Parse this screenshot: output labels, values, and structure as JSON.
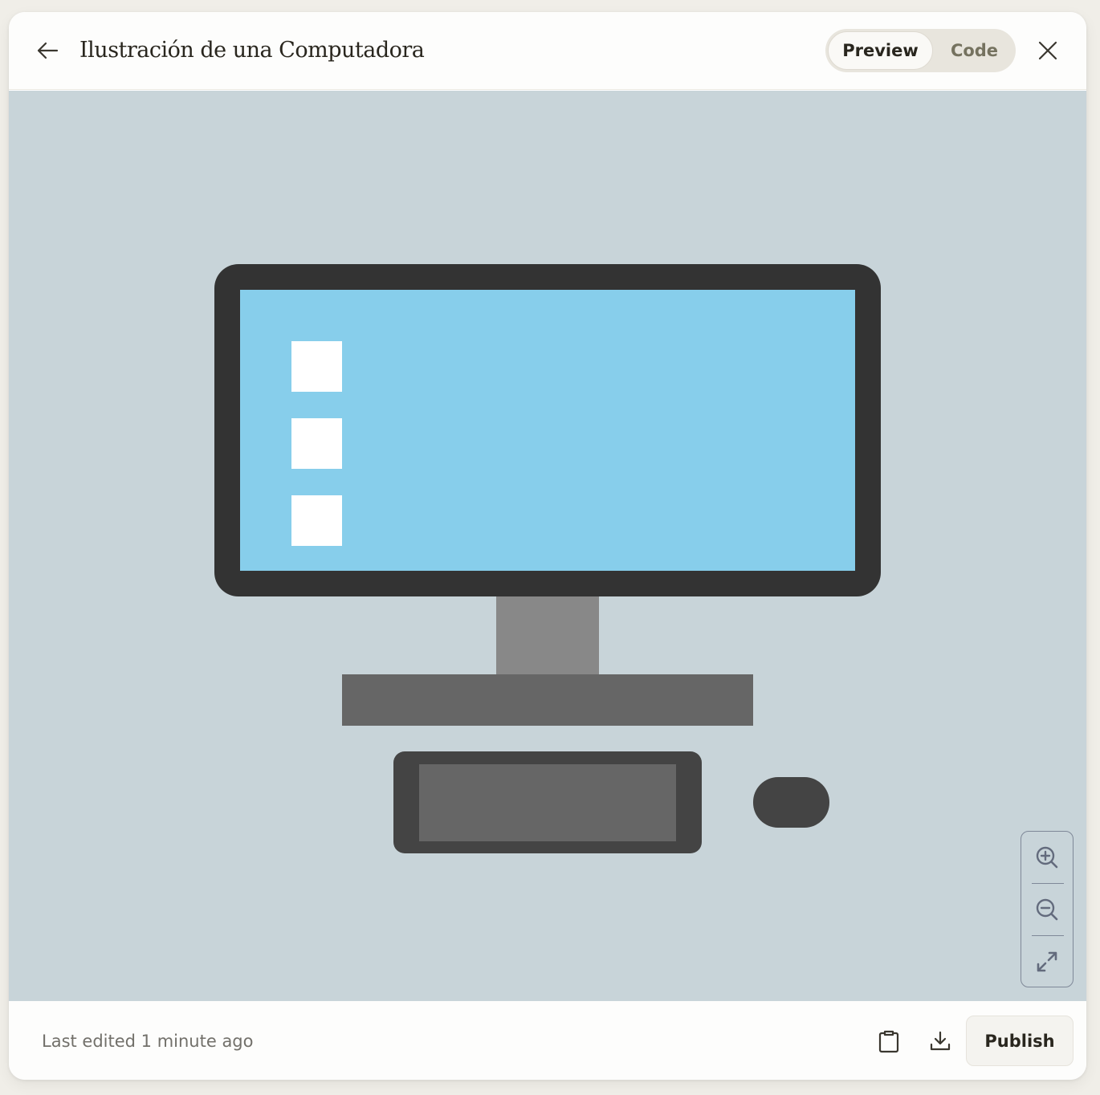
{
  "header": {
    "title": "Ilustración de una Computadora",
    "back_icon": "arrow-left-icon",
    "view_toggle": {
      "options": [
        {
          "label": "Preview",
          "selected": true
        },
        {
          "label": "Code",
          "selected": false
        }
      ]
    },
    "close_icon": "close-icon"
  },
  "canvas": {
    "background": "#c8d4d9",
    "illustration": {
      "monitor_frame_color": "#333333",
      "screen_color": "#87ceeb",
      "desktop_icon_color": "#ffffff",
      "desktop_icon_count": 3,
      "stand_neck_color": "#888888",
      "stand_base_color": "#666666",
      "keyboard_frame_color": "#444444",
      "keyboard_keys_color": "#666666",
      "mouse_color": "#444444"
    },
    "zoom_controls": [
      {
        "icon": "zoom-in-icon",
        "label": "Zoom in"
      },
      {
        "icon": "zoom-out-icon",
        "label": "Zoom out"
      },
      {
        "icon": "expand-icon",
        "label": "Fit / expand"
      }
    ]
  },
  "footer": {
    "last_edited": "Last edited 1 minute ago",
    "copy_icon": "clipboard-icon",
    "download_icon": "download-icon",
    "publish_label": "Publish"
  }
}
